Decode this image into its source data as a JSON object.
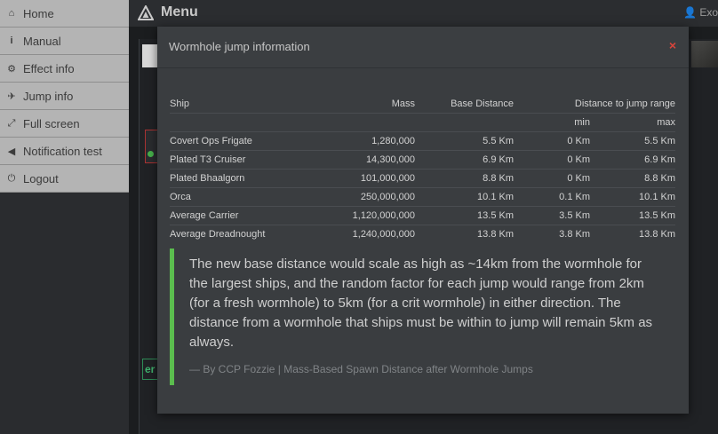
{
  "sidebar": {
    "items": [
      {
        "label": "Home",
        "icon": "home-icon"
      },
      {
        "label": "Manual",
        "icon": "info-icon"
      },
      {
        "label": "Effect info",
        "icon": "cogs-icon"
      },
      {
        "label": "Jump info",
        "icon": "plane-icon"
      },
      {
        "label": "Full screen",
        "icon": "fullscreen-icon"
      },
      {
        "label": "Notification test",
        "icon": "bullhorn-icon"
      },
      {
        "label": "Logout",
        "icon": "power-icon"
      }
    ]
  },
  "topbar": {
    "brand": "Menu",
    "user": "Exo"
  },
  "background": {
    "tab_label": "er"
  },
  "modal": {
    "title": "Wormhole jump information",
    "close": "×",
    "table": {
      "headers": {
        "ship": "Ship",
        "mass": "Mass",
        "base": "Base Distance",
        "range": "Distance to jump range",
        "min": "min",
        "max": "max"
      },
      "rows": [
        {
          "ship": "Covert Ops Frigate",
          "mass": "1,280,000",
          "base": "5.5 Km",
          "min": "0 Km",
          "max": "5.5 Km"
        },
        {
          "ship": "Plated T3 Cruiser",
          "mass": "14,300,000",
          "base": "6.9 Km",
          "min": "0 Km",
          "max": "6.9 Km"
        },
        {
          "ship": "Plated Bhaalgorn",
          "mass": "101,000,000",
          "base": "8.8 Km",
          "min": "0 Km",
          "max": "8.8 Km"
        },
        {
          "ship": "Orca",
          "mass": "250,000,000",
          "base": "10.1 Km",
          "min": "0.1 Km",
          "max": "10.1 Km"
        },
        {
          "ship": "Average Carrier",
          "mass": "1,120,000,000",
          "base": "13.5 Km",
          "min": "3.5 Km",
          "max": "13.5 Km"
        },
        {
          "ship": "Average Dreadnought",
          "mass": "1,240,000,000",
          "base": "13.8 Km",
          "min": "3.8 Km",
          "max": "13.8 Km"
        }
      ]
    },
    "quote": {
      "text": "The new base distance would scale as high as ~14km from the wormhole for the largest ships, and the random factor for each jump would range from 2km (for a fresh wormhole) to 5km (for a crit wormhole) in either direction. The distance from a wormhole that ships must be within to jump will remain 5km as always.",
      "source": "— By CCP Fozzie | Mass-Based Spawn Distance after Wormhole Jumps"
    }
  },
  "colors": {
    "accent_green": "#5bbd4e",
    "close_red": "#d9443b"
  }
}
